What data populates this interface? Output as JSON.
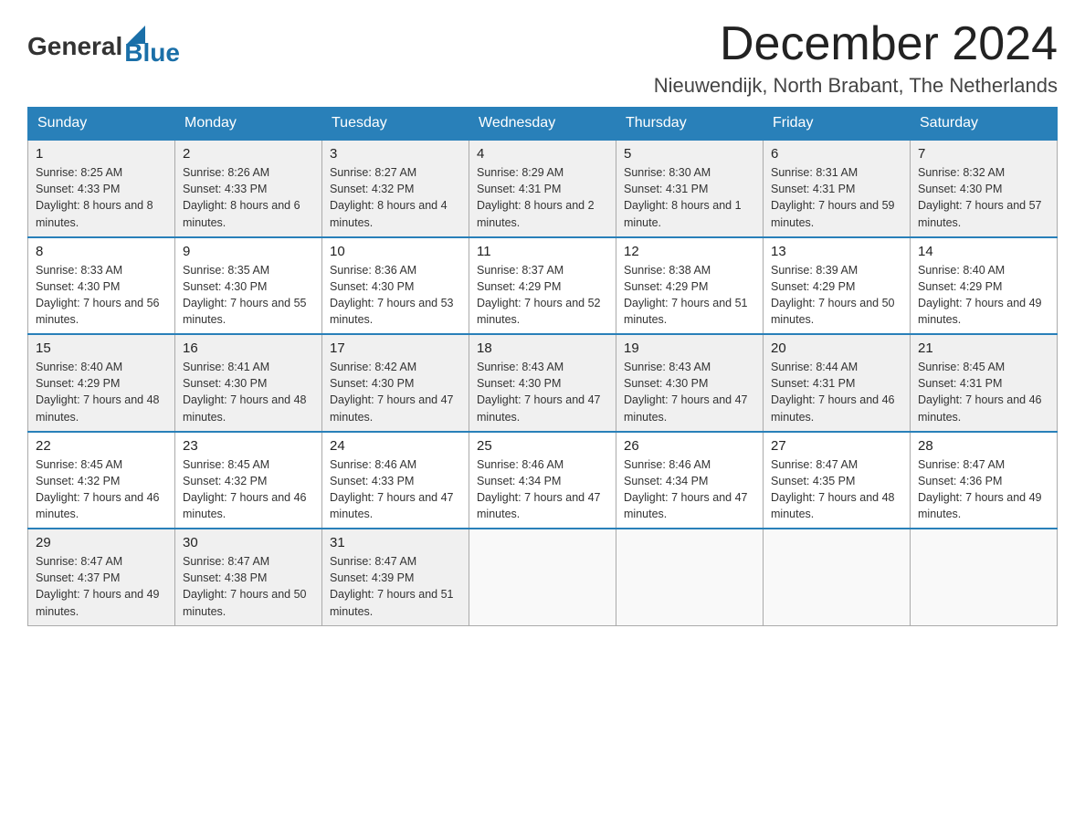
{
  "logo": {
    "general": "General",
    "arrow_color": "#1a6fa8",
    "blue": "Blue"
  },
  "header": {
    "month_year": "December 2024",
    "location": "Nieuwendijk, North Brabant, The Netherlands"
  },
  "weekdays": [
    "Sunday",
    "Monday",
    "Tuesday",
    "Wednesday",
    "Thursday",
    "Friday",
    "Saturday"
  ],
  "weeks": [
    [
      {
        "day": "1",
        "sunrise": "8:25 AM",
        "sunset": "4:33 PM",
        "daylight": "8 hours and 8 minutes."
      },
      {
        "day": "2",
        "sunrise": "8:26 AM",
        "sunset": "4:33 PM",
        "daylight": "8 hours and 6 minutes."
      },
      {
        "day": "3",
        "sunrise": "8:27 AM",
        "sunset": "4:32 PM",
        "daylight": "8 hours and 4 minutes."
      },
      {
        "day": "4",
        "sunrise": "8:29 AM",
        "sunset": "4:31 PM",
        "daylight": "8 hours and 2 minutes."
      },
      {
        "day": "5",
        "sunrise": "8:30 AM",
        "sunset": "4:31 PM",
        "daylight": "8 hours and 1 minute."
      },
      {
        "day": "6",
        "sunrise": "8:31 AM",
        "sunset": "4:31 PM",
        "daylight": "7 hours and 59 minutes."
      },
      {
        "day": "7",
        "sunrise": "8:32 AM",
        "sunset": "4:30 PM",
        "daylight": "7 hours and 57 minutes."
      }
    ],
    [
      {
        "day": "8",
        "sunrise": "8:33 AM",
        "sunset": "4:30 PM",
        "daylight": "7 hours and 56 minutes."
      },
      {
        "day": "9",
        "sunrise": "8:35 AM",
        "sunset": "4:30 PM",
        "daylight": "7 hours and 55 minutes."
      },
      {
        "day": "10",
        "sunrise": "8:36 AM",
        "sunset": "4:30 PM",
        "daylight": "7 hours and 53 minutes."
      },
      {
        "day": "11",
        "sunrise": "8:37 AM",
        "sunset": "4:29 PM",
        "daylight": "7 hours and 52 minutes."
      },
      {
        "day": "12",
        "sunrise": "8:38 AM",
        "sunset": "4:29 PM",
        "daylight": "7 hours and 51 minutes."
      },
      {
        "day": "13",
        "sunrise": "8:39 AM",
        "sunset": "4:29 PM",
        "daylight": "7 hours and 50 minutes."
      },
      {
        "day": "14",
        "sunrise": "8:40 AM",
        "sunset": "4:29 PM",
        "daylight": "7 hours and 49 minutes."
      }
    ],
    [
      {
        "day": "15",
        "sunrise": "8:40 AM",
        "sunset": "4:29 PM",
        "daylight": "7 hours and 48 minutes."
      },
      {
        "day": "16",
        "sunrise": "8:41 AM",
        "sunset": "4:30 PM",
        "daylight": "7 hours and 48 minutes."
      },
      {
        "day": "17",
        "sunrise": "8:42 AM",
        "sunset": "4:30 PM",
        "daylight": "7 hours and 47 minutes."
      },
      {
        "day": "18",
        "sunrise": "8:43 AM",
        "sunset": "4:30 PM",
        "daylight": "7 hours and 47 minutes."
      },
      {
        "day": "19",
        "sunrise": "8:43 AM",
        "sunset": "4:30 PM",
        "daylight": "7 hours and 47 minutes."
      },
      {
        "day": "20",
        "sunrise": "8:44 AM",
        "sunset": "4:31 PM",
        "daylight": "7 hours and 46 minutes."
      },
      {
        "day": "21",
        "sunrise": "8:45 AM",
        "sunset": "4:31 PM",
        "daylight": "7 hours and 46 minutes."
      }
    ],
    [
      {
        "day": "22",
        "sunrise": "8:45 AM",
        "sunset": "4:32 PM",
        "daylight": "7 hours and 46 minutes."
      },
      {
        "day": "23",
        "sunrise": "8:45 AM",
        "sunset": "4:32 PM",
        "daylight": "7 hours and 46 minutes."
      },
      {
        "day": "24",
        "sunrise": "8:46 AM",
        "sunset": "4:33 PM",
        "daylight": "7 hours and 47 minutes."
      },
      {
        "day": "25",
        "sunrise": "8:46 AM",
        "sunset": "4:34 PM",
        "daylight": "7 hours and 47 minutes."
      },
      {
        "day": "26",
        "sunrise": "8:46 AM",
        "sunset": "4:34 PM",
        "daylight": "7 hours and 47 minutes."
      },
      {
        "day": "27",
        "sunrise": "8:47 AM",
        "sunset": "4:35 PM",
        "daylight": "7 hours and 48 minutes."
      },
      {
        "day": "28",
        "sunrise": "8:47 AM",
        "sunset": "4:36 PM",
        "daylight": "7 hours and 49 minutes."
      }
    ],
    [
      {
        "day": "29",
        "sunrise": "8:47 AM",
        "sunset": "4:37 PM",
        "daylight": "7 hours and 49 minutes."
      },
      {
        "day": "30",
        "sunrise": "8:47 AM",
        "sunset": "4:38 PM",
        "daylight": "7 hours and 50 minutes."
      },
      {
        "day": "31",
        "sunrise": "8:47 AM",
        "sunset": "4:39 PM",
        "daylight": "7 hours and 51 minutes."
      },
      null,
      null,
      null,
      null
    ]
  ],
  "labels": {
    "sunrise": "Sunrise:",
    "sunset": "Sunset:",
    "daylight": "Daylight:"
  }
}
